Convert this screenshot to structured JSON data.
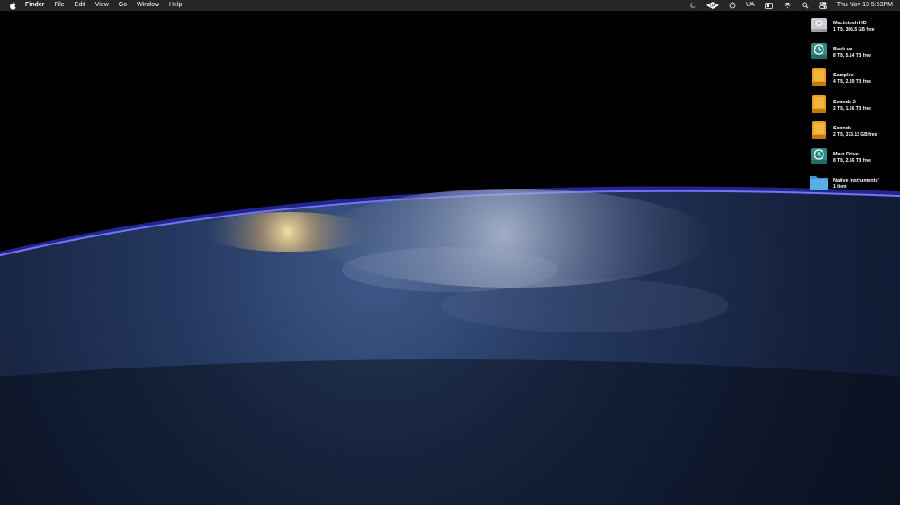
{
  "menubar": {
    "app_name": "Finder",
    "menus": [
      "File",
      "Edit",
      "View",
      "Go",
      "Window",
      "Help"
    ],
    "status": {
      "input_source": "UA",
      "clock": "Thu Nov 13  5:53PM"
    },
    "icons": [
      "apple-icon",
      "ua-logo-icon",
      "time-machine-icon",
      "display-icon",
      "wifi-icon",
      "search-icon",
      "control-center-icon"
    ]
  },
  "desktop_items": [
    {
      "name": "Macintosh HD",
      "info": "1 TB, 386.5 GB free",
      "icon": "internal-drive-icon"
    },
    {
      "name": "Back up",
      "info": "8 TB, 5.14 TB free",
      "icon": "time-machine-drive-icon"
    },
    {
      "name": "Samples",
      "info": "4 TB, 2.39 TB free",
      "icon": "external-drive-icon"
    },
    {
      "name": "Sounds 2",
      "info": "2 TB, 1.66 TB free",
      "icon": "external-drive-icon"
    },
    {
      "name": "Sounds",
      "info": "2 TB, 373.13 GB free",
      "icon": "external-drive-icon"
    },
    {
      "name": "Main Drive",
      "info": "8 TB, 2.66 TB free",
      "icon": "time-machine-drive-icon"
    },
    {
      "name": "Native Instruments’",
      "info": "1 item",
      "icon": "folder-icon"
    }
  ],
  "colors": {
    "menubar_bg": "#282828",
    "atmosphere": "#3a4fff",
    "ocean": "#1a2a55",
    "drive_orange": "#e8a020",
    "time_machine_teal": "#2f8a86",
    "folder_blue": "#5aaee6"
  }
}
